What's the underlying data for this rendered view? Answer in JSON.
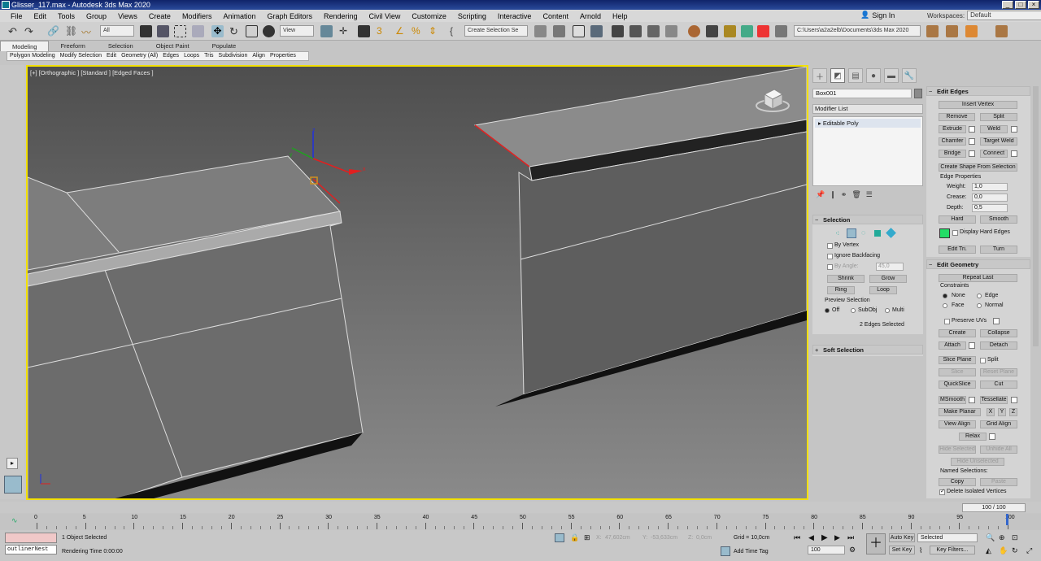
{
  "window": {
    "title": "Glisser_117.max - Autodesk 3ds Max 2020",
    "controls": [
      "_",
      "□",
      "×"
    ]
  },
  "menu": [
    "File",
    "Edit",
    "Tools",
    "Group",
    "Views",
    "Create",
    "Modifiers",
    "Animation",
    "Graph Editors",
    "Rendering",
    "Civil View",
    "Customize",
    "Scripting",
    "Interactive",
    "Content",
    "Arnold",
    "Help"
  ],
  "signin": "Sign In",
  "workspaces": {
    "label": "Workspaces:",
    "value": "Default"
  },
  "toolbar": {
    "filter": "All",
    "view": "View",
    "selection_set": "Create Selection Se",
    "path": "C:\\Users\\a2a2elb\\Documents\\3ds Max 2020"
  },
  "ribbon": {
    "tabs": [
      "Modeling",
      "Freeform",
      "Selection",
      "Object Paint",
      "Populate"
    ],
    "sub": [
      "Polygon Modeling",
      "Modify Selection",
      "Edit",
      "Geometry (All)",
      "Edges",
      "Loops",
      "Tris",
      "Subdivision",
      "Align",
      "Properties"
    ]
  },
  "viewport": {
    "label": "[+] [Orthographic ] [Standard ] [Edged Faces ]",
    "gizmo": {
      "x": "x",
      "y": "y",
      "z": "z"
    }
  },
  "command_panel": {
    "object_name": "Box001",
    "modifier_list": "Modifier List",
    "stack_item": "Editable Poly",
    "selection": {
      "title": "Selection",
      "by_vertex": "By Vertex",
      "ignore_backfacing": "Ignore Backfacing",
      "by_angle": "By Angle:",
      "angle_value": "45,0",
      "shrink": "Shrink",
      "grow": "Grow",
      "ring": "Ring",
      "loop": "Loop",
      "preview": "Preview Selection",
      "off": "Off",
      "subobj": "SubObj",
      "multi": "Multi",
      "status": "2 Edges Selected"
    },
    "soft_selection": "Soft Selection",
    "edit_edges": {
      "title": "Edit Edges",
      "insert_vertex": "Insert Vertex",
      "remove": "Remove",
      "split": "Split",
      "extrude": "Extrude",
      "weld": "Weld",
      "chamfer": "Chamfer",
      "target_weld": "Target Weld",
      "bridge": "Bridge",
      "connect": "Connect",
      "create_shape": "Create Shape From Selection",
      "edge_props": "Edge Properties",
      "weight": "Weight:",
      "weight_val": "1,0",
      "crease": "Crease:",
      "crease_val": "0,0",
      "depth": "Depth:",
      "depth_val": "0,5",
      "hard": "Hard",
      "smooth": "Smooth",
      "display_hard": "Display Hard Edges",
      "edit_tri": "Edit Tri.",
      "turn": "Turn"
    },
    "edit_geometry": {
      "title": "Edit Geometry",
      "repeat_last": "Repeat Last",
      "constraints": "Constraints",
      "none": "None",
      "edge": "Edge",
      "face": "Face",
      "normal": "Normal",
      "preserve_uvs": "Preserve UVs",
      "create": "Create",
      "collapse": "Collapse",
      "attach": "Attach",
      "detach": "Detach",
      "slice_plane": "Slice Plane",
      "split": "Split",
      "slice": "Slice",
      "reset_plane": "Reset Plane",
      "quickslice": "QuickSlice",
      "cut": "Cut",
      "msmooth": "MSmooth",
      "tessellate": "Tessellate",
      "make_planar": "Make Planar",
      "x": "X",
      "y": "Y",
      "z": "Z",
      "view_align": "View Align",
      "grid_align": "Grid Align",
      "relax": "Relax",
      "hide_selected": "Hide Selected",
      "unhide_all": "Unhide All",
      "hide_unselected": "Hide Unselected",
      "named_selections": "Named Selections:",
      "copy": "Copy",
      "paste": "Paste",
      "delete_isolated": "Delete Isolated Vertices"
    }
  },
  "timeline": {
    "slider": "100 / 100",
    "ticks": [
      "0",
      "5",
      "10",
      "15",
      "20",
      "25",
      "30",
      "35",
      "40",
      "45",
      "50",
      "55",
      "60",
      "65",
      "70",
      "75",
      "80",
      "85",
      "90",
      "95",
      "100"
    ]
  },
  "status": {
    "maxscript": "outlinerNest",
    "selected": "1 Object Selected",
    "rendering": "Rendering Time  0:00:00",
    "x_label": "X:",
    "x_val": "47,602cm",
    "y_label": "Y:",
    "y_val": "-53,633cm",
    "z_label": "Z:",
    "z_val": "0,0cm",
    "grid": "Grid = 10,0cm",
    "add_time_tag": "Add Time Tag",
    "auto_key": "Auto Key",
    "set_key": "Set Key",
    "selected_drop": "Selected",
    "key_filters": "Key Filters...",
    "frame": "100"
  },
  "colors": {
    "viewport_border": "#f2e000",
    "hard_edge_swatch": "#22dd66",
    "title_bg": "#10246a"
  }
}
